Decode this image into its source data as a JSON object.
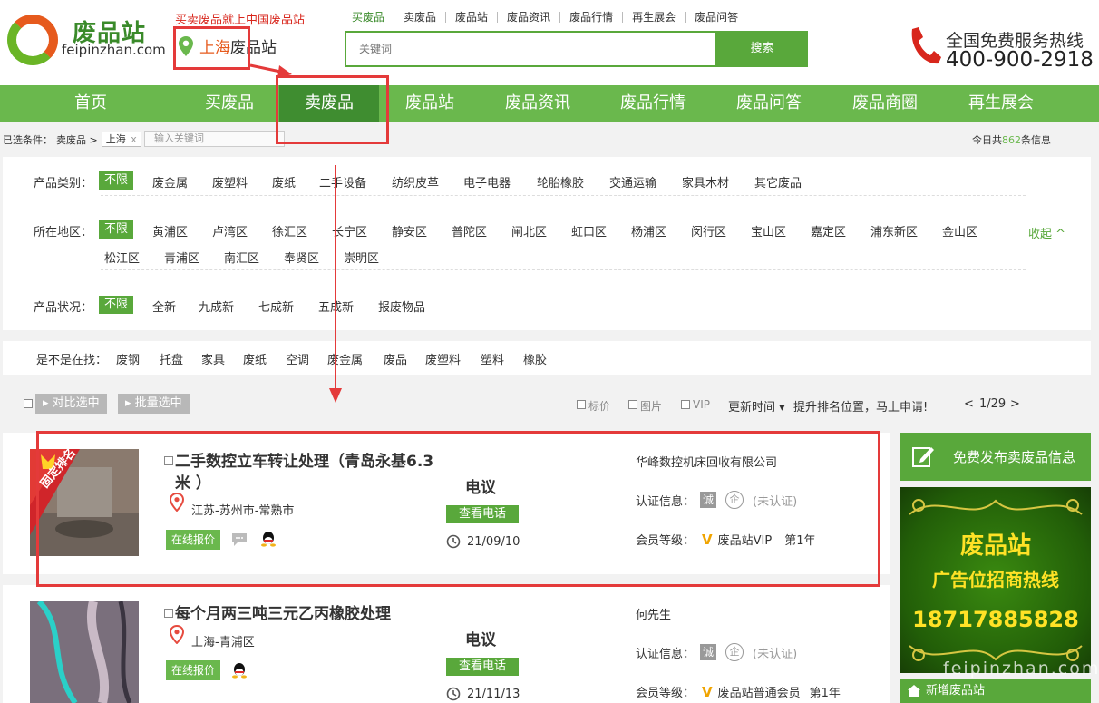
{
  "header": {
    "logo_name": "废品站",
    "logo_domain": "feipinzhan.com",
    "slogan": "买卖废品就上中国废品站",
    "city": "上海",
    "city_suffix": "废品站",
    "top_links": [
      "买废品",
      "卖废品",
      "废品站",
      "废品资讯",
      "废品行情",
      "再生展会",
      "废品问答"
    ],
    "search_placeholder": "关键词",
    "search_button": "搜索",
    "hotline_label": "全国免费服务热线",
    "hotline_number": "400-900-2918"
  },
  "nav": {
    "items": [
      "首页",
      "买废品",
      "卖废品",
      "废品站",
      "废品资讯",
      "废品行情",
      "废品问答",
      "废品商圈",
      "再生展会"
    ],
    "active_index": 2
  },
  "conditions": {
    "label": "已选条件：",
    "crumb": "卖废品 >",
    "tag": "上海",
    "tag_close": "x",
    "keyword_placeholder": "输入关键词",
    "today_prefix": "今日共",
    "today_count": "862",
    "today_suffix": "条信息"
  },
  "filters": {
    "category": {
      "label": "产品类别：",
      "options": [
        "不限",
        "废金属",
        "废塑料",
        "废纸",
        "二手设备",
        "纺织皮革",
        "电子电器",
        "轮胎橡胶",
        "交通运输",
        "家具木材",
        "其它废品"
      ]
    },
    "region": {
      "label": "所在地区：",
      "options_row1": [
        "不限",
        "黄浦区",
        "卢湾区",
        "徐汇区",
        "长宁区",
        "静安区",
        "普陀区",
        "闸北区",
        "虹口区",
        "杨浦区",
        "闵行区",
        "宝山区",
        "嘉定区",
        "浦东新区",
        "金山区"
      ],
      "options_row2": [
        "松江区",
        "青浦区",
        "南汇区",
        "奉贤区",
        "崇明区"
      ],
      "collapse": "收起 ^"
    },
    "condition": {
      "label": "产品状况：",
      "options": [
        "不限",
        "全新",
        "九成新",
        "七成新",
        "五成新",
        "报废物品"
      ]
    }
  },
  "suggest": {
    "label": "是不是在找：",
    "items": [
      "废钢",
      "托盘",
      "家具",
      "废纸",
      "空调",
      "废金属",
      "废品",
      "废塑料",
      "塑料",
      "橡胶"
    ]
  },
  "toolbar": {
    "compare": "▸ 对比选中",
    "batch": "▸ 批量选中",
    "filter_price": "标价",
    "filter_image": "图片",
    "filter_vip": "VIP",
    "sort": "更新时间 ▾",
    "promo": "提升排名位置，马上申请!",
    "page": "1/29",
    "prev": "<",
    "next": ">"
  },
  "listings": [
    {
      "badge": "固定排名",
      "title": "二手数控立车转让处理（青岛永基6.3米 ）",
      "location": "江苏-苏州市-常熟市",
      "quote": "在线报价",
      "price": "电议",
      "phone_btn": "查看电话",
      "date": "21/09/10",
      "company": "华峰数控机床回收有限公司",
      "cert_label": "认证信息：",
      "cert_box": "诚",
      "cert_circle": "企",
      "cert_status": "(未认证)",
      "member_label": "会员等级：",
      "member_icon": "V",
      "member_level": "废品站VIP",
      "member_year": "第1年"
    },
    {
      "title": "每个月两三吨三元乙丙橡胶处理",
      "location": "上海-青浦区",
      "quote": "在线报价",
      "price": "电议",
      "phone_btn": "查看电话",
      "date": "21/11/13",
      "company": "何先生",
      "cert_label": "认证信息：",
      "cert_box": "诚",
      "cert_circle": "企",
      "cert_status": "(未认证)",
      "member_label": "会员等级：",
      "member_icon": "V",
      "member_level": "废品站普通会员",
      "member_year": "第1年"
    }
  ],
  "sidebar": {
    "publish": "免费发布卖废品信息",
    "ad_line1": "废品站",
    "ad_line2": "广告位招商热线",
    "ad_line3": "18717885828",
    "new_station": "新增废品站",
    "watermark": "feipinzhan.com"
  },
  "colors": {
    "brand_green": "#6ab84d",
    "dark_green": "#3f8d30",
    "annotation_red": "#e43a3a",
    "accent_orange": "#e65a1d"
  }
}
